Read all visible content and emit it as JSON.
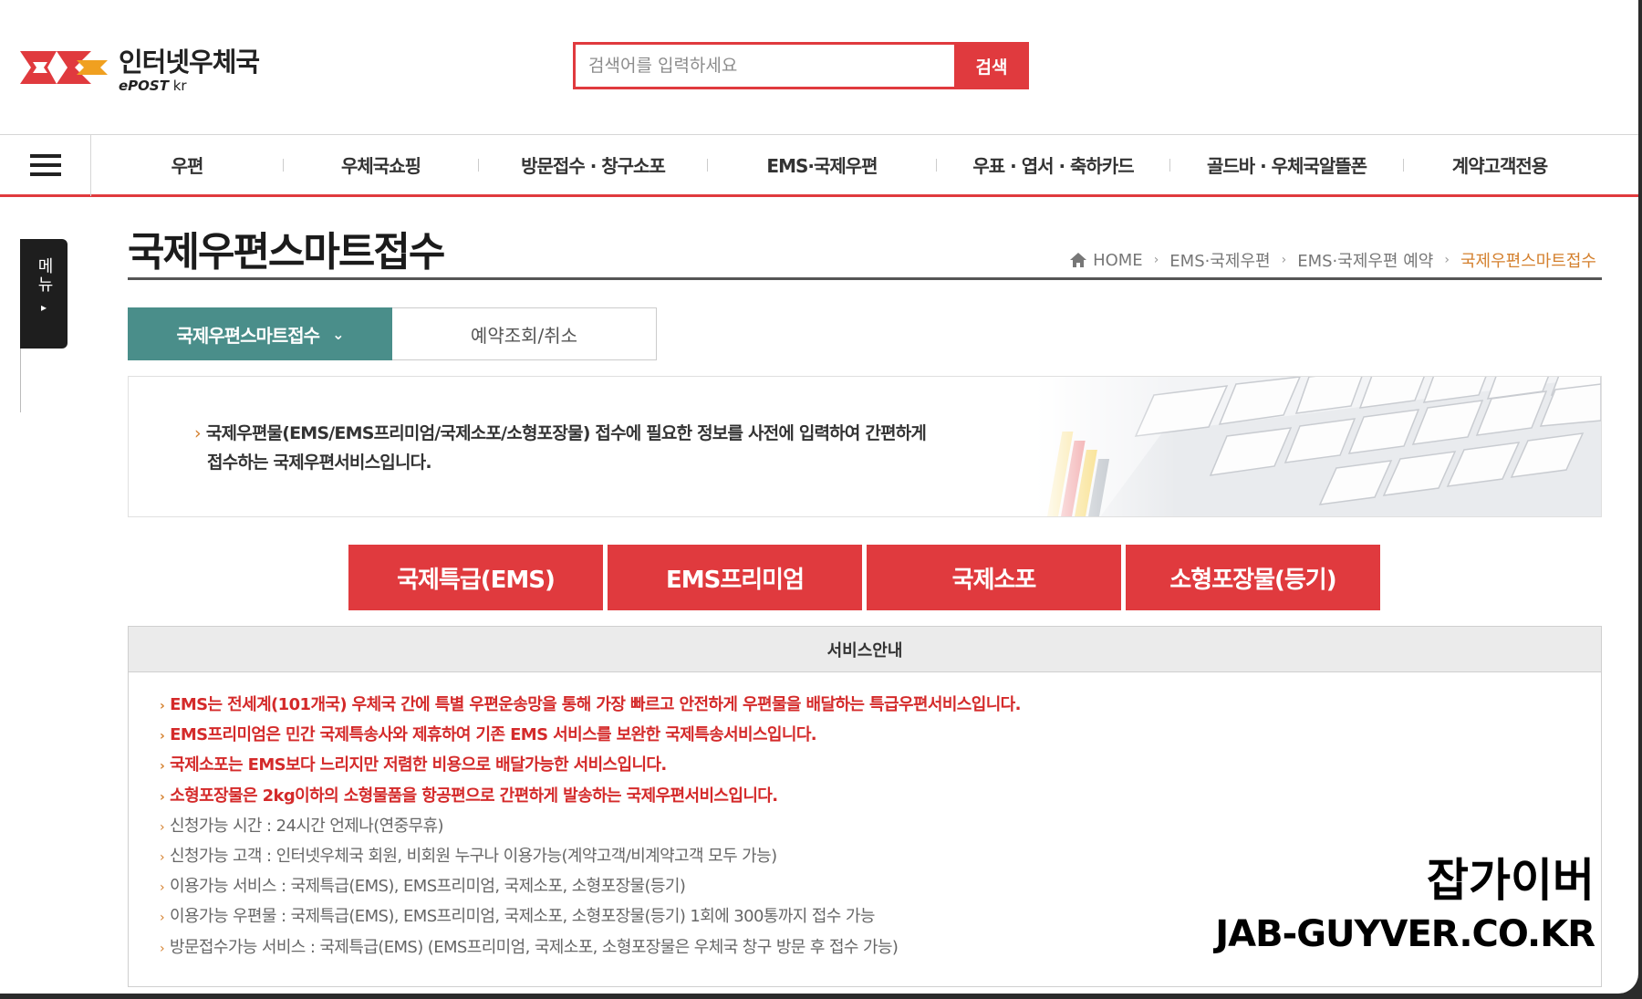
{
  "brand": {
    "name_kr": "인터넷우체국",
    "name_en_bold": "ePOST",
    "name_en_suffix": " kr"
  },
  "search": {
    "placeholder": "검색어를 입력하세요",
    "button_label": "검색"
  },
  "gnb": {
    "items": [
      "우편",
      "우체국쇼핑",
      "방문접수 · 창구소포",
      "EMS·국제우편",
      "우표 · 엽서 · 축하카드",
      "골드바 · 우체국알뜰폰",
      "계약고객전용"
    ]
  },
  "side_menu": {
    "label": "메뉴",
    "arrow": "▸"
  },
  "page": {
    "title": "국제우편스마트접수",
    "breadcrumb": [
      "HOME",
      "EMS·국제우편",
      "EMS·국제우편 예약",
      "국제우편스마트접수"
    ]
  },
  "tabs": [
    {
      "label": "국제우편스마트접수",
      "active": true
    },
    {
      "label": "예약조회/취소",
      "active": false
    }
  ],
  "banner": {
    "line1": "국제우편물(EMS/EMS프리미엄/국제소포/소형포장물) 접수에 필요한 정보를 사전에 입력하여 간편하게",
    "line2": "접수하는 국제우편서비스입니다."
  },
  "service_buttons": [
    "국제특급(EMS)",
    "EMS프리미엄",
    "국제소포",
    "소형포장물(등기)"
  ],
  "guide": {
    "title": "서비스안내",
    "items": [
      {
        "text": "EMS는 전세계(101개국) 우체국 간에 특별 우편운송망을 통해 가장 빠르고 안전하게 우편물을 배달하는 특급우편서비스입니다.",
        "style": "red"
      },
      {
        "text": "EMS프리미엄은 민간 국제특송사와 제휴하여 기존 EMS 서비스를 보완한 국제특송서비스입니다.",
        "style": "red"
      },
      {
        "text": "국제소포는 EMS보다 느리지만 저렴한 비용으로 배달가능한 서비스입니다.",
        "style": "red"
      },
      {
        "text": "소형포장물은 2kg이하의 소형물품을 항공편으로 간편하게 발송하는 국제우편서비스입니다.",
        "style": "red"
      },
      {
        "text": "신청가능 시간 : 24시간 언제나(연중무휴)",
        "style": "gray"
      },
      {
        "text": "신청가능 고객 : 인터넷우체국 회원, 비회원 누구나 이용가능(계약고객/비계약고객 모두 가능)",
        "style": "gray"
      },
      {
        "text": "이용가능 서비스 : 국제특급(EMS), EMS프리미엄, 국제소포, 소형포장물(등기)",
        "style": "gray"
      },
      {
        "text": "이용가능 우편물 : 국제특급(EMS), EMS프리미엄, 국제소포, 소형포장물(등기) 1회에 300통까지 접수 가능",
        "style": "gray"
      },
      {
        "text": "방문접수가능 서비스 : 국제특급(EMS) (EMS프리미엄, 국제소포, 소형포장물은 우체국 창구 방문 후 접수 가능)",
        "style": "gray"
      }
    ]
  },
  "watermark": {
    "kr": "잡가이버",
    "en": "JAB-GUYVER.CO.KR"
  },
  "colors": {
    "accent_red": "#e03a3e",
    "tab_teal": "#4a8e8a",
    "breadcrumb_current": "#d4802e"
  }
}
